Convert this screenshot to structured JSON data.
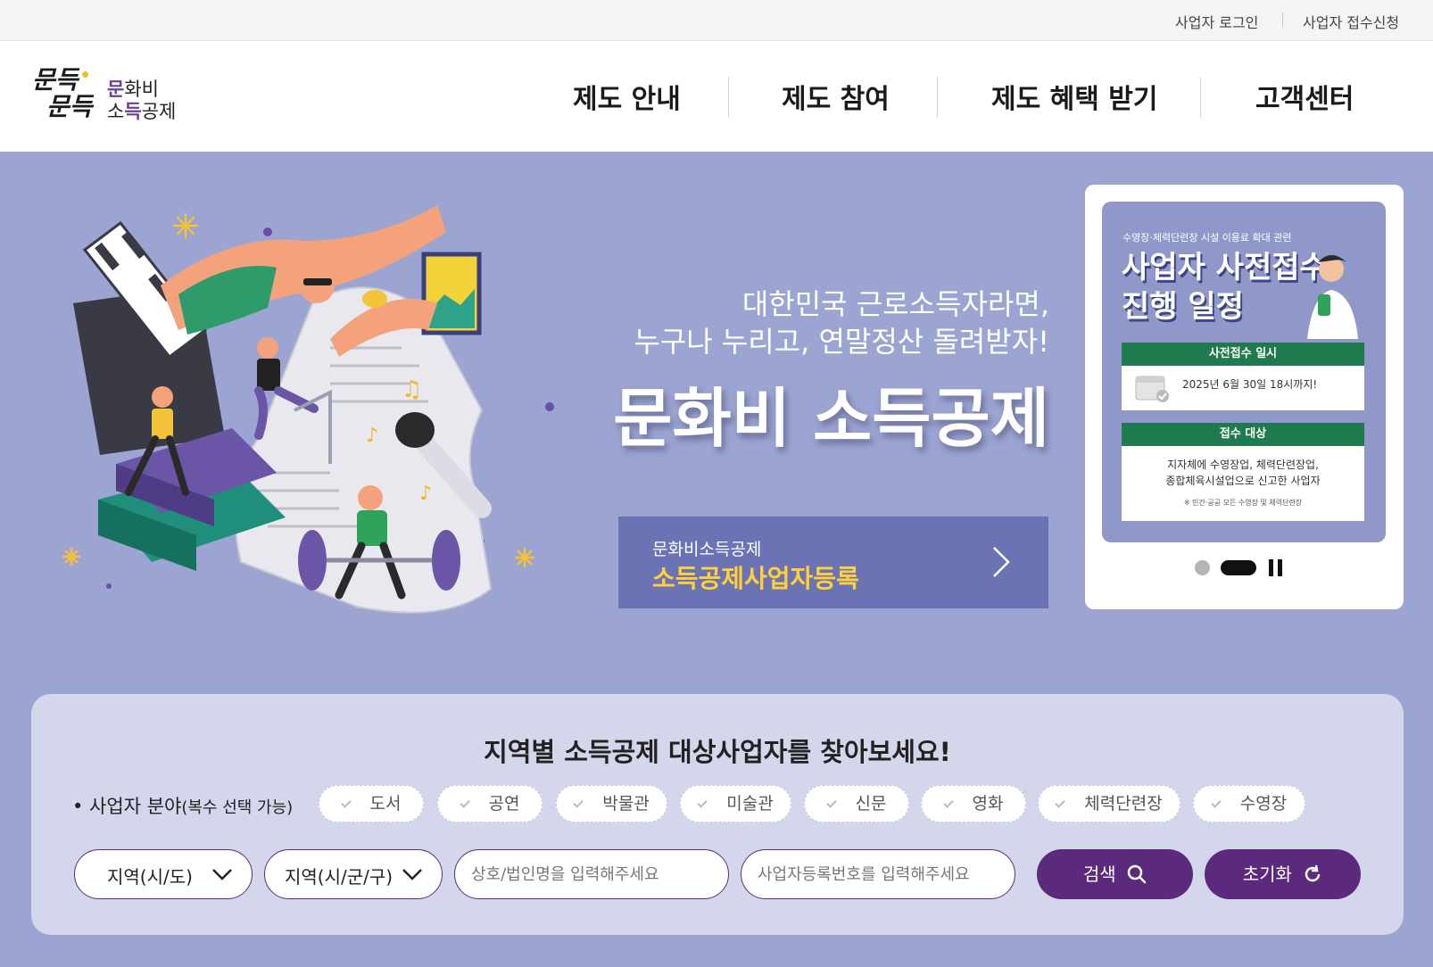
{
  "utility": {
    "login": "사업자 로그인",
    "apply": "사업자 접수신청"
  },
  "logo": {
    "mark_line1": "문득",
    "mark_line2": "문득",
    "text_line1_accent": "문",
    "text_line1_rest": "화비",
    "text_line2_a": "소",
    "text_line2_accent": "득",
    "text_line2_rest": "공제"
  },
  "nav": {
    "items": [
      "제도 안내",
      "제도 참여",
      "제도 혜택 받기",
      "고객센터"
    ]
  },
  "hero": {
    "subtitle_line1": "대한민국 근로소득자라면,",
    "subtitle_line2": "누구나 누리고, 연말정산 돌려받자!",
    "title": "문화비 소득공제",
    "cta_small": "문화비소득공제",
    "cta_big": "소득공제사업자등록"
  },
  "banner": {
    "kicker": "수영장·체력단련장 시설 이용료 확대 관련",
    "title_line1": "사업자 사전접수",
    "title_line2": "진행 일정",
    "box1_head": "사전접수 일시",
    "box1_body": "2025년 6월 30일 18시까지!",
    "box2_head": "접수 대상",
    "box2_line1": "지자체에 수영장업, 체력단련장업,",
    "box2_line2": "종합체육시설업으로 신고한 사업자",
    "box2_note": "※ 민간·공공 모든 수영장 및 체력단련장",
    "slides_total": 2,
    "slide_active": 2
  },
  "search": {
    "title": "지역별 소득공제 대상사업자를 찾아보세요!",
    "field_label_main": "• 사업자 분야",
    "field_label_note": "(복수 선택 가능)",
    "categories": [
      "도서",
      "공연",
      "박물관",
      "미술관",
      "신문",
      "영화",
      "체력단련장",
      "수영장"
    ],
    "region_sido": "지역(시/도)",
    "region_sigungu": "지역(시/군/구)",
    "name_placeholder": "상호/법인명을 입력해주세요",
    "bizno_placeholder": "사업자등록번호를 입력해주세요",
    "search_label": "검색",
    "reset_label": "초기화"
  },
  "colors": {
    "hero_bg": "#9ca5d2",
    "cta_bg": "#6c73b4",
    "cta_accent": "#ffd03a",
    "primary_button": "#5b2a7d",
    "banner_green": "#1f7a4f",
    "panel_bg": "#d4d6ec"
  }
}
